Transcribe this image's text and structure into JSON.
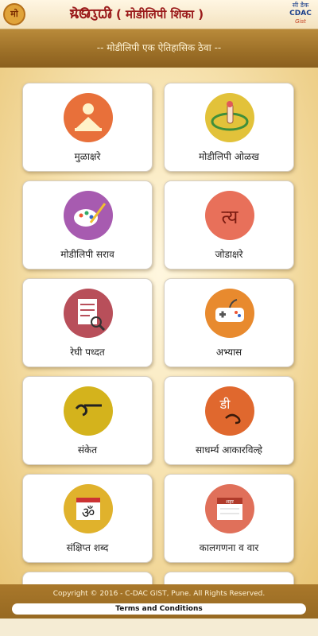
{
  "header": {
    "logo_left_text": "मो",
    "title_modi": "𑘦𑘻𑘚𑘲𑘩𑘲𑘢𑘲",
    "title_sub": "( मोडीलिपी शिका )",
    "logo_right": {
      "line1": "सी डैक",
      "line2": "CDAC",
      "line3": "Gist"
    }
  },
  "tagline": "-- मोडीलिपी एक ऐतिहासिक ठेवा --",
  "tiles": [
    {
      "label": "मुळाक्षरे",
      "icon": "learning-alphabets-icon",
      "color": "#e8703a"
    },
    {
      "label": "मोडीलिपी ओळख",
      "icon": "touch-globe-icon",
      "color": "#e2c23a"
    },
    {
      "label": "मोडीलिपी सराव",
      "icon": "paint-palette-icon",
      "color": "#a75bb0"
    },
    {
      "label": "जोडाक्षरे",
      "icon": "conjunct-letter-icon",
      "color": "#e8705a",
      "glyph": "त्य"
    },
    {
      "label": "रेघी पध्दत",
      "icon": "line-writing-icon",
      "color": "#b84f5a"
    },
    {
      "label": "अभ्यास",
      "icon": "gamepad-icon",
      "color": "#e88a2e"
    },
    {
      "label": "संकेत",
      "icon": "sign-symbol-icon",
      "color": "#d4b31c"
    },
    {
      "label": "साधर्म्य आकारविल्हे",
      "icon": "similar-shapes-icon",
      "color": "#e0682e",
      "glyph": "डी"
    },
    {
      "label": "संक्षिप्त शब्द",
      "icon": "abbreviation-calendar-icon",
      "color": "#e0b22c",
      "glyph": "ॐ"
    },
    {
      "label": "कालगणना व वार",
      "icon": "calendar-icon",
      "color": "#e0705a",
      "glyph": "शहर"
    }
  ],
  "footer": {
    "copyright": "Copyright © 2016 - C-DAC GIST, Pune. All Rights Reserved.",
    "terms": "Terms and Conditions"
  }
}
